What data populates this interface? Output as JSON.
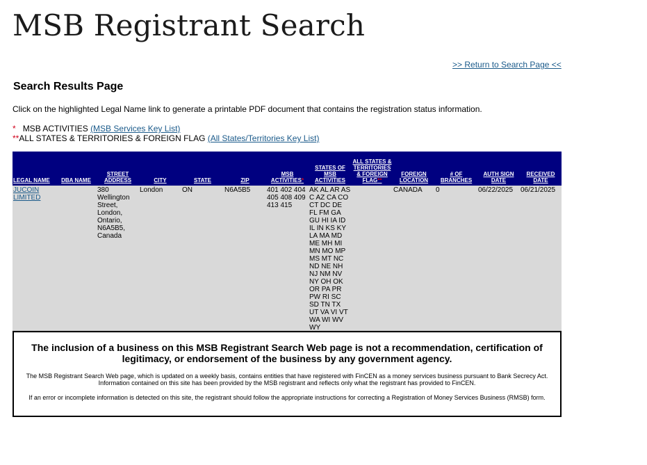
{
  "page": {
    "title": "MSB Registrant Search",
    "return_link": ">> Return to Search Page <<",
    "subheading": "Search Results Page",
    "instructions": "Click on the highlighted Legal Name link to generate a printable PDF document that contains the registration status information."
  },
  "legend": {
    "msb_marker": "*",
    "msb_label": "MSB ACTIVITIES",
    "msb_link": "(MSB Services Key List)",
    "states_marker": "**",
    "states_label": "ALL STATES & TERRITORIES & FOREIGN FLAG",
    "states_link": "(All States/Territories Key List)"
  },
  "table": {
    "headers": {
      "legal_name": "LEGAL NAME",
      "dba_name": "DBA NAME",
      "street_address": "STREET ADDRESS",
      "city": "CITY",
      "state": "STATE",
      "zip": "ZIP",
      "msb_activities": "MSB ACTIVITIES",
      "msb_activities_marker": "*",
      "states_of_msb_activities": "STATES OF MSB ACTIVITIES",
      "all_states": "ALL STATES & TERRITORIES & FOREIGN FLAG",
      "all_states_marker": "**",
      "foreign_location": "FOREIGN LOCATION",
      "num_branches": "# OF BRANCHES",
      "auth_sign_date": "AUTH SIGN DATE",
      "received_date": "RECEIVED DATE"
    },
    "row": {
      "legal_name": "JUCOIN LIMITED",
      "dba_name": "",
      "street_address": "380 Wellington Street, London, Ontario, N6A5B5, Canada",
      "city": "London",
      "state": "ON",
      "zip": "N6A5B5",
      "msb_activities": "401 402 404 405 408 409 413 415",
      "states_of_msb_activities": "AK AL AR AS C AZ CA CO CT DC DE FL FM GA GU HI IA ID IL IN KS KY LA MA MD ME MH MI MN MO MP MS MT NC ND NE NH NJ NM NV NY OH OK OR PA PR PW RI SC SD TN TX UT VA VI VT WA WI WV WY",
      "all_states": "",
      "foreign_location": "CANADA",
      "num_branches": "0",
      "auth_sign_date": "06/22/2025",
      "received_date": "06/21/2025"
    }
  },
  "disclaimer": {
    "main": "The inclusion of a business on this MSB Registrant Search Web page is not a recommendation, certification of legitimacy, or endorsement of the business by any government agency.",
    "para1": "The MSB Registrant Search Web page, which is updated on a weekly basis, contains entities that have registered with FinCEN as a money services business pursuant to Bank Secrecy Act. Information contained on this site has been provided by the MSB registrant and reflects only what the registrant has provided to FinCEN.",
    "para2": "If an error or incomplete information is detected on this site, the registrant should follow the appropriate instructions for correcting a Registration of Money Services Business (RMSB) form."
  }
}
